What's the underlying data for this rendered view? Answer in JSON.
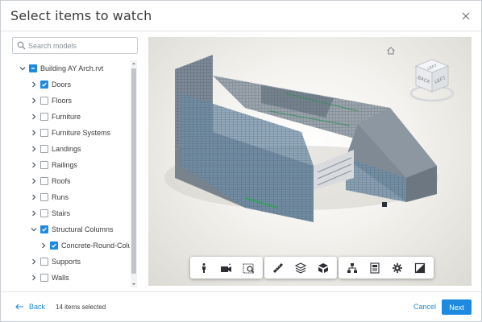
{
  "dialog": {
    "title": "Select items to watch",
    "close_icon": "close-icon"
  },
  "search": {
    "placeholder": "Search models",
    "icon": "search-icon"
  },
  "tree": {
    "items": [
      {
        "label": "Building AY Arch.rvt",
        "expanded": true,
        "state": "partial",
        "level": 0
      },
      {
        "label": "Doors",
        "expanded": false,
        "state": "checked",
        "level": 1
      },
      {
        "label": "Floors",
        "expanded": false,
        "state": "unchecked",
        "level": 1
      },
      {
        "label": "Furniture",
        "expanded": false,
        "state": "unchecked",
        "level": 1
      },
      {
        "label": "Furniture Systems",
        "expanded": false,
        "state": "unchecked",
        "level": 1
      },
      {
        "label": "Landings",
        "expanded": false,
        "state": "unchecked",
        "level": 1
      },
      {
        "label": "Railings",
        "expanded": false,
        "state": "unchecked",
        "level": 1
      },
      {
        "label": "Roofs",
        "expanded": false,
        "state": "unchecked",
        "level": 1
      },
      {
        "label": "Runs",
        "expanded": false,
        "state": "unchecked",
        "level": 1
      },
      {
        "label": "Stairs",
        "expanded": false,
        "state": "unchecked",
        "level": 1
      },
      {
        "label": "Structural Columns",
        "expanded": true,
        "state": "checked",
        "level": 1
      },
      {
        "label": "Concrete-Round-Colu...",
        "expanded": false,
        "state": "checked",
        "level": 2
      },
      {
        "label": "Supports",
        "expanded": false,
        "state": "unchecked",
        "level": 1
      },
      {
        "label": "Walls",
        "expanded": false,
        "state": "unchecked",
        "level": 1
      }
    ]
  },
  "viewer": {
    "viewcube_faces": {
      "top": "LEFT",
      "front": "BACK",
      "right": "LEFT"
    },
    "toolbar_groups": [
      [
        "walk-icon",
        "camera-icon",
        "zoom-window-icon"
      ],
      [
        "measure-icon",
        "section-icon",
        "explode-icon"
      ],
      [
        "model-browser-icon",
        "properties-icon",
        "settings-icon",
        "fullscreen-icon"
      ]
    ]
  },
  "footer": {
    "back_label": "Back",
    "selected_count": "14 items selected",
    "cancel_label": "Cancel",
    "next_label": "Next"
  },
  "colors": {
    "accent": "#1d8ae0",
    "building_glass": "#6f8fa8",
    "building_wall": "#8a939c"
  }
}
